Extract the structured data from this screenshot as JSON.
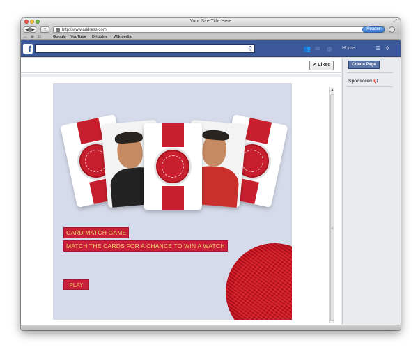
{
  "browser": {
    "title": "Your Site Title Here",
    "url": "http://www.address.com",
    "reader_label": "Reader",
    "bookmarks": [
      "Google",
      "YouTube",
      "Dribbble",
      "Wikipedia"
    ]
  },
  "facebook": {
    "logo_letter": "f",
    "home_label": "Home",
    "liked_label": "Liked",
    "create_page_label": "Create Page",
    "sponsored_label": "Sponsored"
  },
  "game": {
    "title": "CARD MATCH GAME",
    "subtitle": "MATCH THE CARDS FOR A CHANCE TO WIN A WATCH",
    "play_label": "PLAY"
  },
  "colors": {
    "facebook_blue": "#3b5998",
    "game_red": "#c8203a",
    "game_text": "#f3d36b",
    "canvas_bg": "#d5dbea"
  }
}
